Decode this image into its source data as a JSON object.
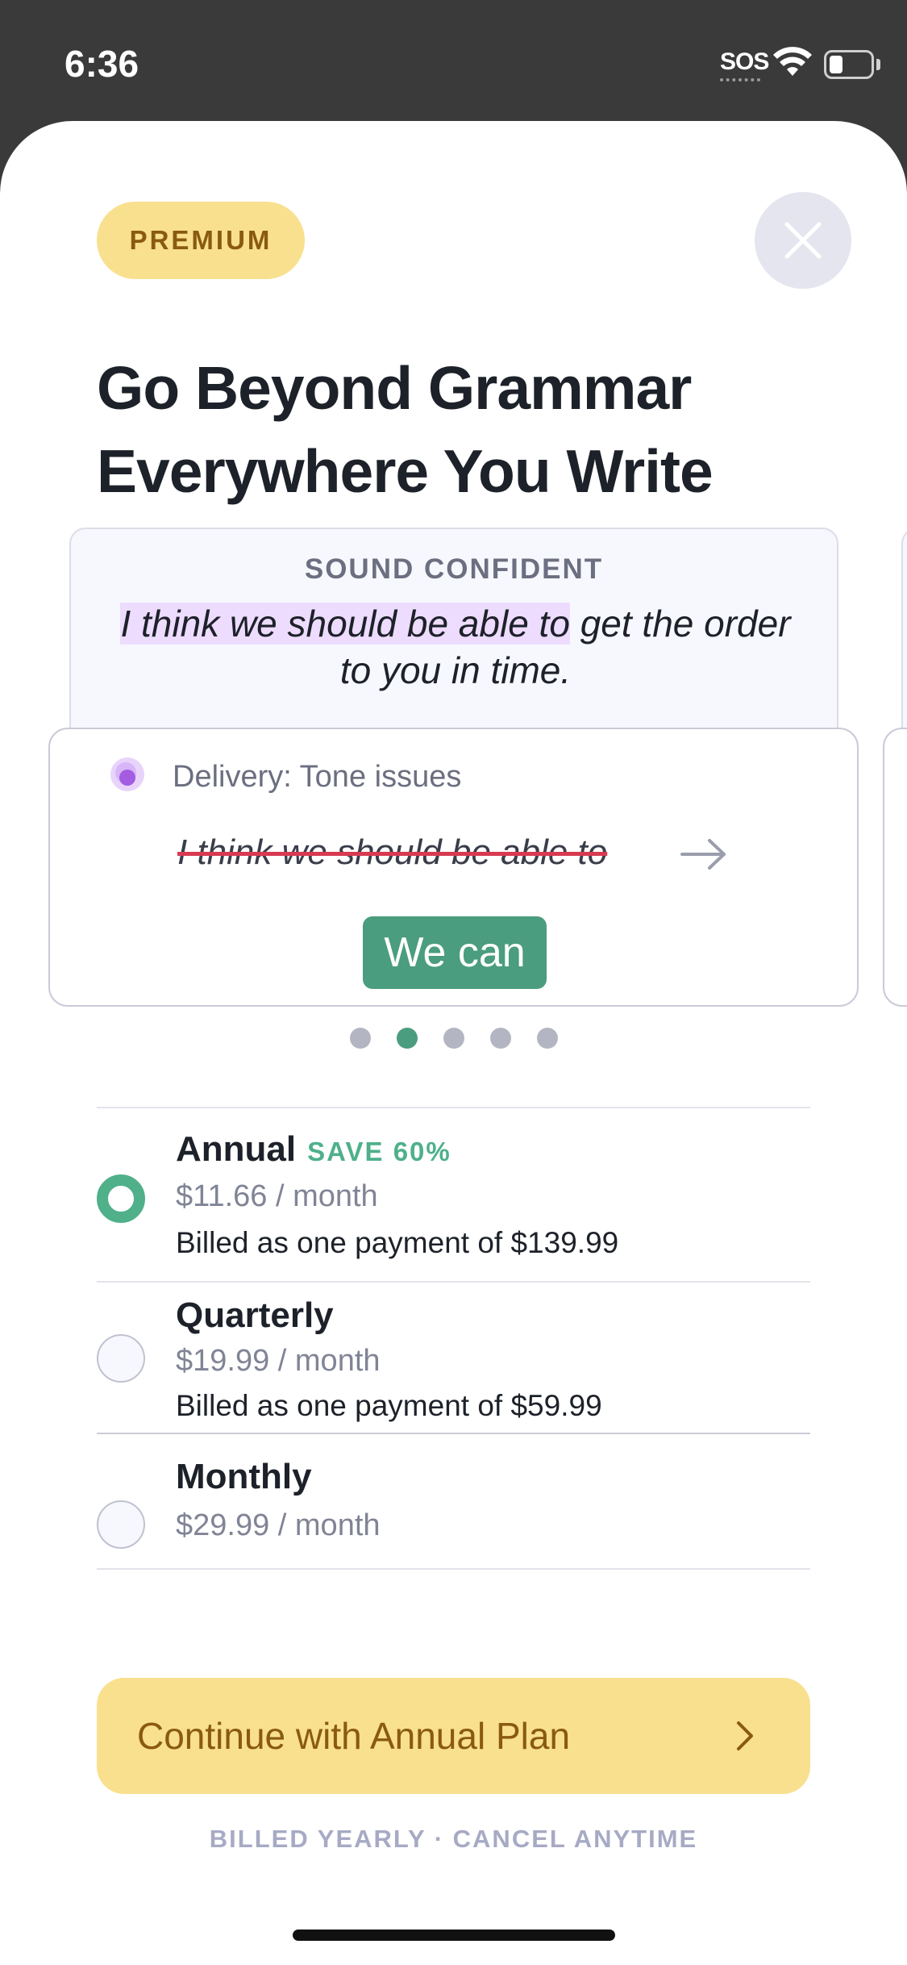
{
  "status_bar": {
    "time": "6:36",
    "sos": "SOS"
  },
  "badge": {
    "label": "PREMIUM"
  },
  "title": "Go Beyond Grammar Everywhere You Write",
  "example": {
    "label": "SOUND CONFIDENT",
    "highlighted": "I think we should be able to",
    "rest": " get the order to you in time."
  },
  "suggestion": {
    "category": "Delivery: Tone issues",
    "struck": "I think we should be able to",
    "replacement": "We can"
  },
  "carousel": {
    "total": 5,
    "active_index": 1
  },
  "plans": [
    {
      "name": "Annual",
      "save": "SAVE 60%",
      "price": "$11.66 / month",
      "billed": "Billed as one payment of $139.99",
      "selected": true
    },
    {
      "name": "Quarterly",
      "save": "",
      "price": "$19.99 / month",
      "billed": "Billed as one payment of $59.99",
      "selected": false
    },
    {
      "name": "Monthly",
      "save": "",
      "price": "$29.99 / month",
      "billed": "",
      "selected": false
    }
  ],
  "cta": {
    "label": "Continue with Annual Plan"
  },
  "footnote": "BILLED YEARLY · CANCEL ANYTIME",
  "colors": {
    "accent_yellow": "#f8e08e",
    "accent_green": "#4fb08a",
    "highlight_purple": "#eedcff",
    "strike_red": "#d83a52"
  },
  "icons": {
    "close": "close-icon",
    "tone": "tone-indicator-icon",
    "arrow": "arrow-right-icon",
    "chevron": "chevron-right-icon",
    "wifi": "wifi-icon",
    "battery": "battery-icon"
  }
}
